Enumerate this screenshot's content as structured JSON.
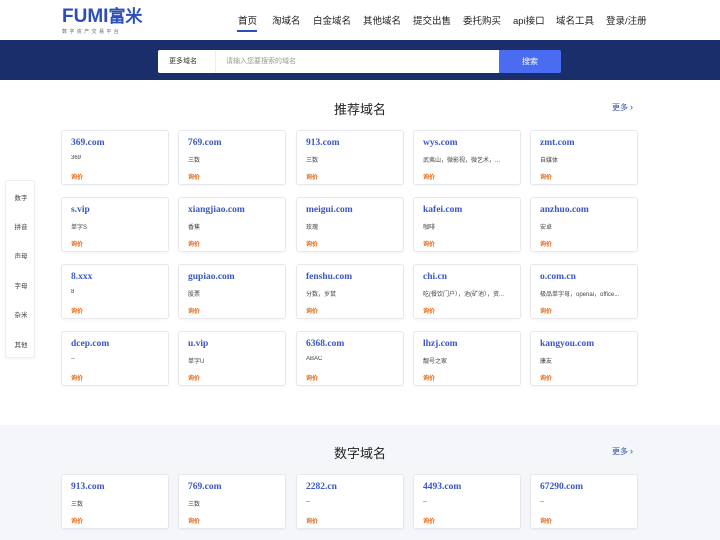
{
  "brand": {
    "logo_text": "FUMI",
    "logo_cn": "富米",
    "tagline": "数字资产交易平台"
  },
  "nav": {
    "items": [
      {
        "label": "首页",
        "active": true
      },
      {
        "label": "淘域名"
      },
      {
        "label": "白金域名"
      },
      {
        "label": "其他域名"
      },
      {
        "label": "提交出售"
      },
      {
        "label": "委托购买"
      },
      {
        "label": "api接口"
      },
      {
        "label": "域名工具"
      },
      {
        "label": "登录/注册"
      }
    ]
  },
  "search": {
    "select_label": "更多域名",
    "placeholder": "请输入您要搜索的域名",
    "button_label": "搜索"
  },
  "side_menu": [
    "数字",
    "拼音",
    "声母",
    "字母",
    "杂米",
    "其他"
  ],
  "recommended": {
    "title": "推荐域名",
    "more": "更多",
    "cards": [
      {
        "domain": "369.com",
        "desc": "369",
        "price": "询价"
      },
      {
        "domain": "769.com",
        "desc": "三数",
        "price": "询价"
      },
      {
        "domain": "913.com",
        "desc": "三数",
        "price": "询价"
      },
      {
        "domain": "wys.com",
        "desc": "武夷山，微影视，微艺术，...",
        "price": "询价"
      },
      {
        "domain": "zmt.com",
        "desc": "自媒体",
        "price": "询价"
      },
      {
        "domain": "s.vip",
        "desc": "单字S",
        "price": "询价"
      },
      {
        "domain": "xiangjiao.com",
        "desc": "香蕉",
        "price": "询价"
      },
      {
        "domain": "meigui.com",
        "desc": "玫瑰",
        "price": "询价"
      },
      {
        "domain": "kafei.com",
        "desc": "咖啡",
        "price": "询价"
      },
      {
        "domain": "anzhuo.com",
        "desc": "安卓",
        "price": "询价"
      },
      {
        "domain": "8.xxx",
        "desc": "8",
        "price": "询价"
      },
      {
        "domain": "gupiao.com",
        "desc": "股票",
        "price": "询价"
      },
      {
        "domain": "fenshu.com",
        "desc": "分数，岁鼠",
        "price": "询价"
      },
      {
        "domain": "chi.cn",
        "desc": "吃(餐饮门户），池(矿池），资...",
        "price": "询价"
      },
      {
        "domain": "o.com.cn",
        "desc": "极品单字母，openai，office...",
        "price": "询价"
      },
      {
        "domain": "dcep.com",
        "desc": "--",
        "price": "询价"
      },
      {
        "domain": "u.vip",
        "desc": "单字U",
        "price": "询价"
      },
      {
        "domain": "6368.com",
        "desc": "ABAC",
        "price": "询价"
      },
      {
        "domain": "lhzj.com",
        "desc": "靓号之家",
        "price": "询价"
      },
      {
        "domain": "kangyou.com",
        "desc": "康友",
        "price": "询价"
      }
    ]
  },
  "numeric": {
    "title": "数字域名",
    "more": "更多",
    "cards": [
      {
        "domain": "913.com",
        "desc": "三数",
        "price": "询价"
      },
      {
        "domain": "769.com",
        "desc": "三数",
        "price": "询价"
      },
      {
        "domain": "2282.cn",
        "desc": "--",
        "price": "询价"
      },
      {
        "domain": "4493.com",
        "desc": "--",
        "price": "询价"
      },
      {
        "domain": "67290.com",
        "desc": "--",
        "price": "询价"
      }
    ]
  },
  "colors": {
    "brand_blue": "#2b4fb8",
    "search_band": "#1a2e6b",
    "search_button": "#4a6cf0",
    "price_orange": "#e46a17"
  }
}
